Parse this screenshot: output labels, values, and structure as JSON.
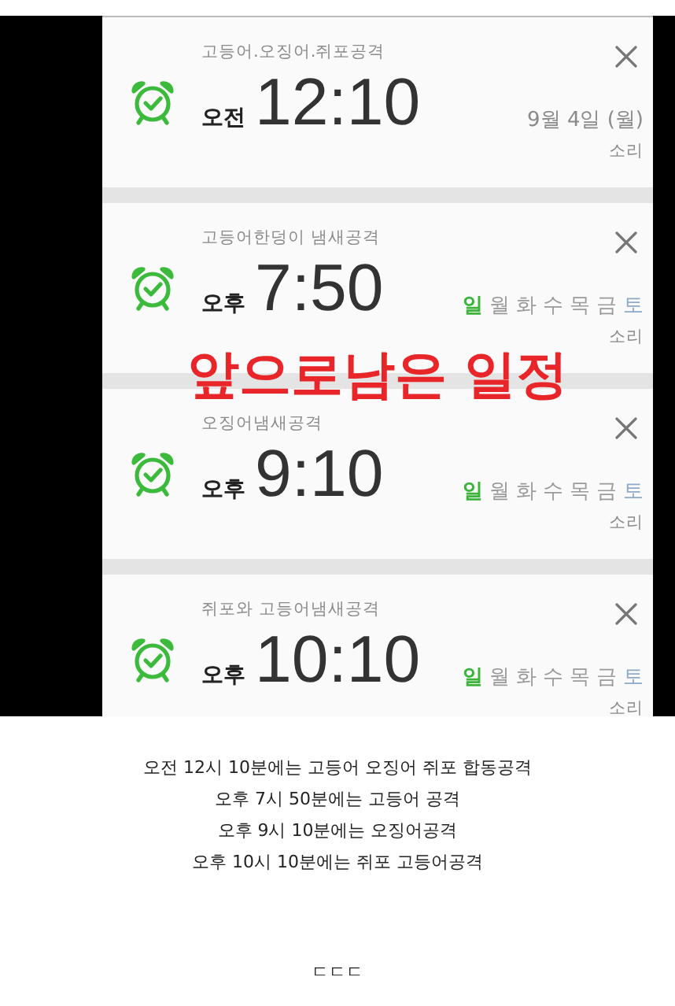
{
  "alarms": [
    {
      "label": "고등어.오징어.쥐포공격",
      "meridiem": "오전",
      "time": "12:10",
      "kind": "date",
      "date": "9월 4일 (월)",
      "sound": "소리"
    },
    {
      "label": "고등어한덩이 냄새공격",
      "meridiem": "오후",
      "time": "7:50",
      "kind": "days",
      "days": [
        {
          "label": "일",
          "selected": true,
          "color": "#3cb43c"
        },
        {
          "label": "월",
          "selected": false,
          "color": "#9a9a9a"
        },
        {
          "label": "화",
          "selected": false,
          "color": "#9a9a9a"
        },
        {
          "label": "수",
          "selected": false,
          "color": "#9a9a9a"
        },
        {
          "label": "목",
          "selected": false,
          "color": "#9a9a9a"
        },
        {
          "label": "금",
          "selected": false,
          "color": "#9a9a9a"
        },
        {
          "label": "토",
          "selected": false,
          "color": "#8fa9c8"
        }
      ],
      "sound": "소리"
    },
    {
      "label": "오징어냄새공격",
      "meridiem": "오후",
      "time": "9:10",
      "kind": "days",
      "days": [
        {
          "label": "일",
          "selected": true,
          "color": "#3cb43c"
        },
        {
          "label": "월",
          "selected": false,
          "color": "#9a9a9a"
        },
        {
          "label": "화",
          "selected": false,
          "color": "#9a9a9a"
        },
        {
          "label": "수",
          "selected": false,
          "color": "#9a9a9a"
        },
        {
          "label": "목",
          "selected": false,
          "color": "#9a9a9a"
        },
        {
          "label": "금",
          "selected": false,
          "color": "#9a9a9a"
        },
        {
          "label": "토",
          "selected": false,
          "color": "#8fa9c8"
        }
      ],
      "sound": "소리"
    },
    {
      "label": "쥐포와 고등어냄새공격",
      "meridiem": "오후",
      "time": "10:10",
      "kind": "days",
      "days": [
        {
          "label": "일",
          "selected": true,
          "color": "#3cb43c"
        },
        {
          "label": "월",
          "selected": false,
          "color": "#9a9a9a"
        },
        {
          "label": "화",
          "selected": false,
          "color": "#9a9a9a"
        },
        {
          "label": "수",
          "selected": false,
          "color": "#9a9a9a"
        },
        {
          "label": "목",
          "selected": false,
          "color": "#9a9a9a"
        },
        {
          "label": "금",
          "selected": false,
          "color": "#9a9a9a"
        },
        {
          "label": "토",
          "selected": false,
          "color": "#8fa9c8"
        }
      ],
      "sound": "소리"
    }
  ],
  "overlay_caption": "앞으로남은 일정",
  "caption_lines": [
    "오전 12시 10분에는 고등어 오징어 쥐포 합동공격",
    "오후 7시 50분에는 고등어 공격",
    "오후 9시 10분에는 오징어공격",
    "오후 10시 10분에는 쥐포 고등어공격"
  ],
  "footer": "ㄷㄷㄷ"
}
